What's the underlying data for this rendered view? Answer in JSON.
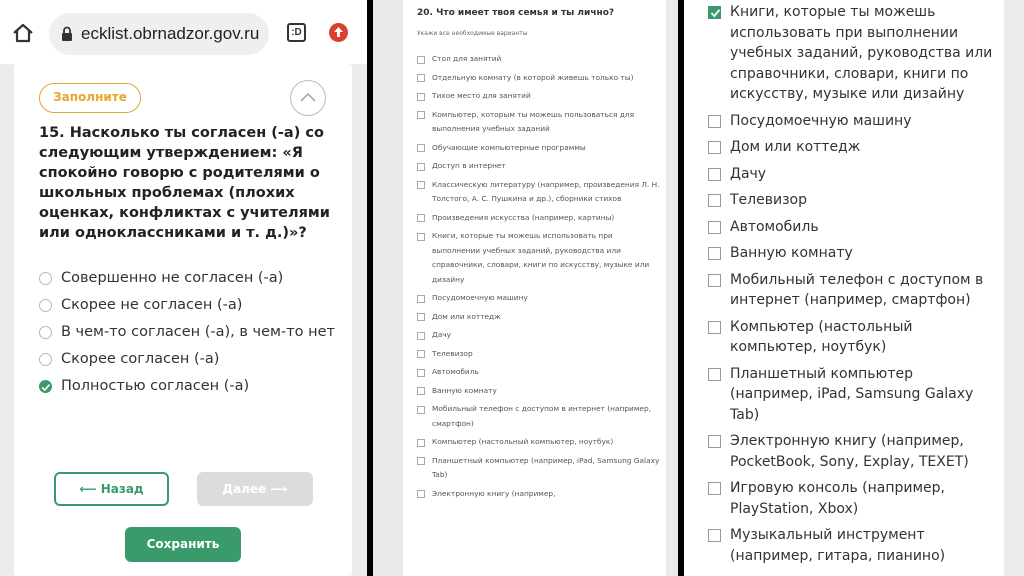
{
  "left": {
    "url": "ecklist.obrnadzor.gov.ru",
    "tab_count": ":D",
    "badge": "Заполните",
    "question": "15. Насколько ты согласен (-а) со следующим утверждением: «Я спокойно говорю с родителями о школьных проблемах (плохих оценках, конфликтах с учителями или одноклассниками и т. д.)»?",
    "options": [
      {
        "label": "Совершенно не согласен (-а)"
      },
      {
        "label": "Скорее не согласен (-а)"
      },
      {
        "label": "В чем-то согласен (-а), в чем-то нет"
      },
      {
        "label": "Скорее согласен (-а)"
      },
      {
        "label": "Полностью согласен (-а)"
      }
    ],
    "selected_option": 4,
    "back_label": "⟵ Назад",
    "next_label": "Далее ⟶",
    "save_label": "Сохранить"
  },
  "middle": {
    "title": "20. Что имеет твоя семья и ты лично?",
    "hint": "Укажи все необходимые варианты",
    "items": [
      "Стол для занятий",
      "Отдельную комнату (в которой живешь только ты)",
      "Тихое место для занятий",
      "Компьютер, которым ты можешь пользоваться для выполнения учебных заданий",
      "Обучающие компьютерные программы",
      "Доступ в интернет",
      "Классическую литературу (например, произведения Л. Н. Толстого, А. С. Пушкина и др.), сборники стихов",
      "Произведения искусства (например, картины)",
      "Книги, которые ты можешь использовать при выполнении учебных заданий, руководства или справочники, словари, книги по искусству, музыке или дизайну",
      "Посудомоечную машину",
      "Дом или коттедж",
      "Дачу",
      "Телевизор",
      "Автомобиль",
      "Ванную комнату",
      "Мобильный телефон с доступом в интернет (например, смартфон)",
      "Компьютер (настольный компьютер, ноутбук)",
      "Планшетный компьютер (например, iPad, Samsung Galaxy Tab)",
      "Электронную книгу (например,"
    ]
  },
  "right": {
    "items": [
      {
        "label": "Книги, которые ты можешь использовать при выполнении учебных заданий, руководства или справочники, словари, книги по искусству, музыке или дизайну",
        "checked": true
      },
      {
        "label": "Посудомоечную машину",
        "checked": false
      },
      {
        "label": "Дом или коттедж",
        "checked": false
      },
      {
        "label": "Дачу",
        "checked": false
      },
      {
        "label": "Телевизор",
        "checked": false
      },
      {
        "label": "Автомобиль",
        "checked": false
      },
      {
        "label": "Ванную комнату",
        "checked": false
      },
      {
        "label": "Мобильный телефон с доступом в интернет (например, смартфон)",
        "checked": false
      },
      {
        "label": "Компьютер (настольный компьютер, ноутбук)",
        "checked": false
      },
      {
        "label": "Планшетный компьютер (например, iPad, Samsung Galaxy Tab)",
        "checked": false
      },
      {
        "label": "Электронную книгу (например, PocketBook, Sony, Explay, TEXET)",
        "checked": false
      },
      {
        "label": "Игровую консоль (например, PlayStation, Xbox)",
        "checked": false
      },
      {
        "label": "Музыкальный инструмент (например, гитара, пианино)",
        "checked": false
      }
    ]
  },
  "icons": {
    "home": "home-icon",
    "lock": "lock-icon",
    "tabs": "tab-switcher-icon",
    "upload": "upload-icon",
    "collapse": "chevron-up-icon",
    "checkmark": "checkmark-icon"
  },
  "colors": {
    "accent_green": "#3a9a6b",
    "badge_orange": "#e6a630",
    "disabled_gray": "#dcdcdc",
    "upload_red": "#d9412c"
  }
}
